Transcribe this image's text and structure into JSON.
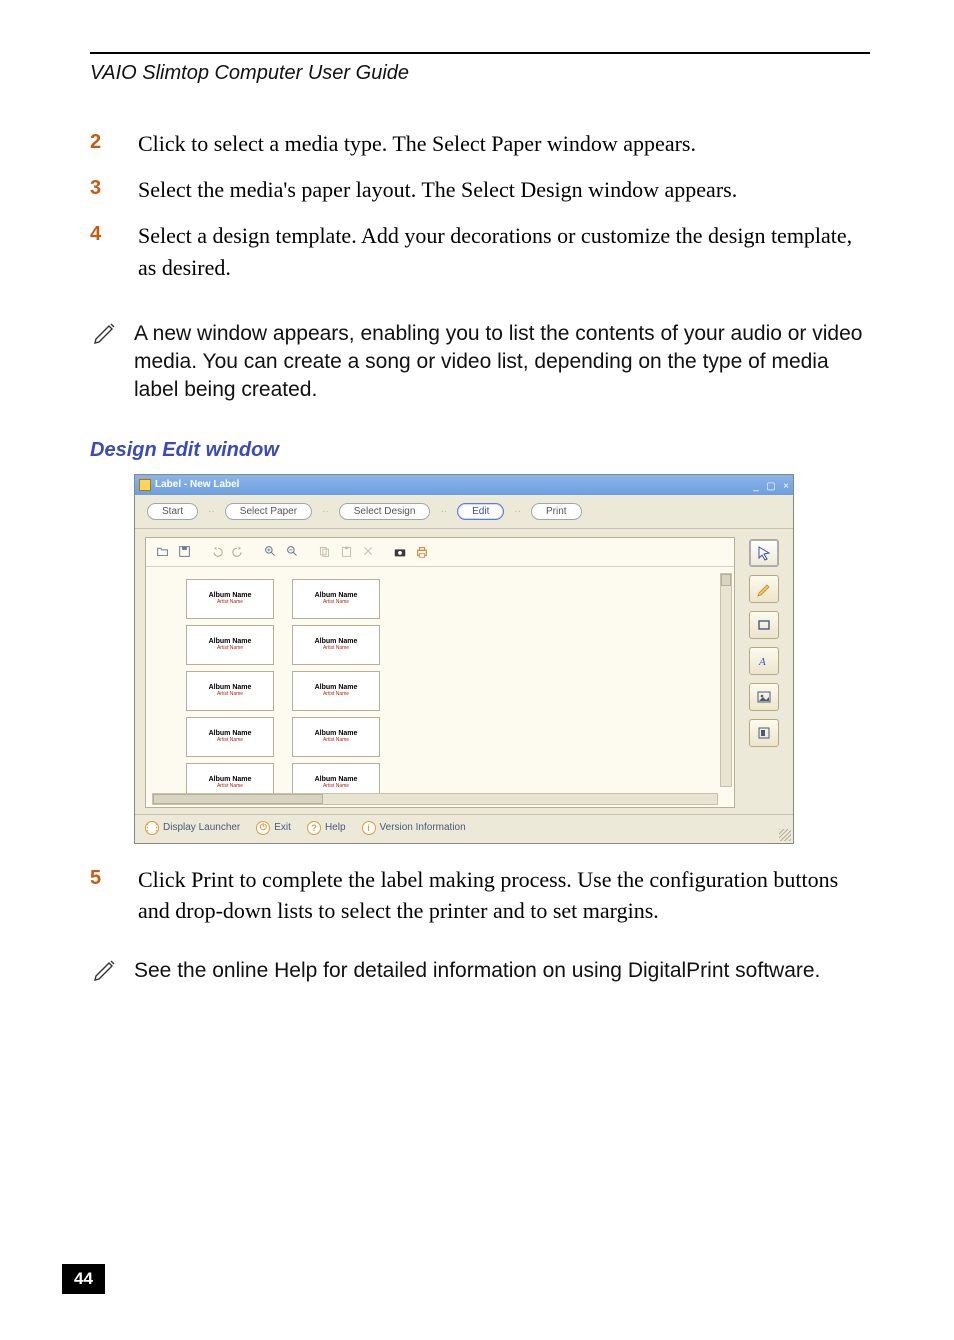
{
  "header": {
    "title": "VAIO Slimtop Computer User Guide"
  },
  "steps": {
    "s2": {
      "num": "2",
      "txt": "Click to select a media type. The Select Paper window appears."
    },
    "s3": {
      "num": "3",
      "txt": "Select the media's paper layout. The Select Design window appears."
    },
    "s4": {
      "num": "4",
      "txt": "Select a design template. Add your decorations or customize the design template, as desired."
    },
    "s5": {
      "num": "5",
      "txt": "Click Print to complete the label making process. Use the configuration buttons and drop-down lists to select the printer and to set margins."
    }
  },
  "notes": {
    "n1": "A new window appears, enabling you to list the contents of your audio or video media. You can create a song or video list, depending on the type of media label being created.",
    "n2": "See the online Help for detailed information on using DigitalPrint software."
  },
  "section_subtitle": "Design Edit window",
  "window": {
    "title": "Label - New Label",
    "ctrls": {
      "min": "_",
      "max": "▢",
      "close": "×"
    },
    "stepbar": {
      "start": "Start",
      "select_paper": "Select Paper",
      "select_design": "Select Design",
      "edit": "Edit",
      "print": "Print"
    },
    "label_card": {
      "album": "Album Name",
      "artist": "Artist Name"
    },
    "footer": {
      "display_launcher": "Display Launcher",
      "exit": "Exit",
      "help": "Help",
      "version": "Version Information"
    }
  },
  "page_number": "44"
}
